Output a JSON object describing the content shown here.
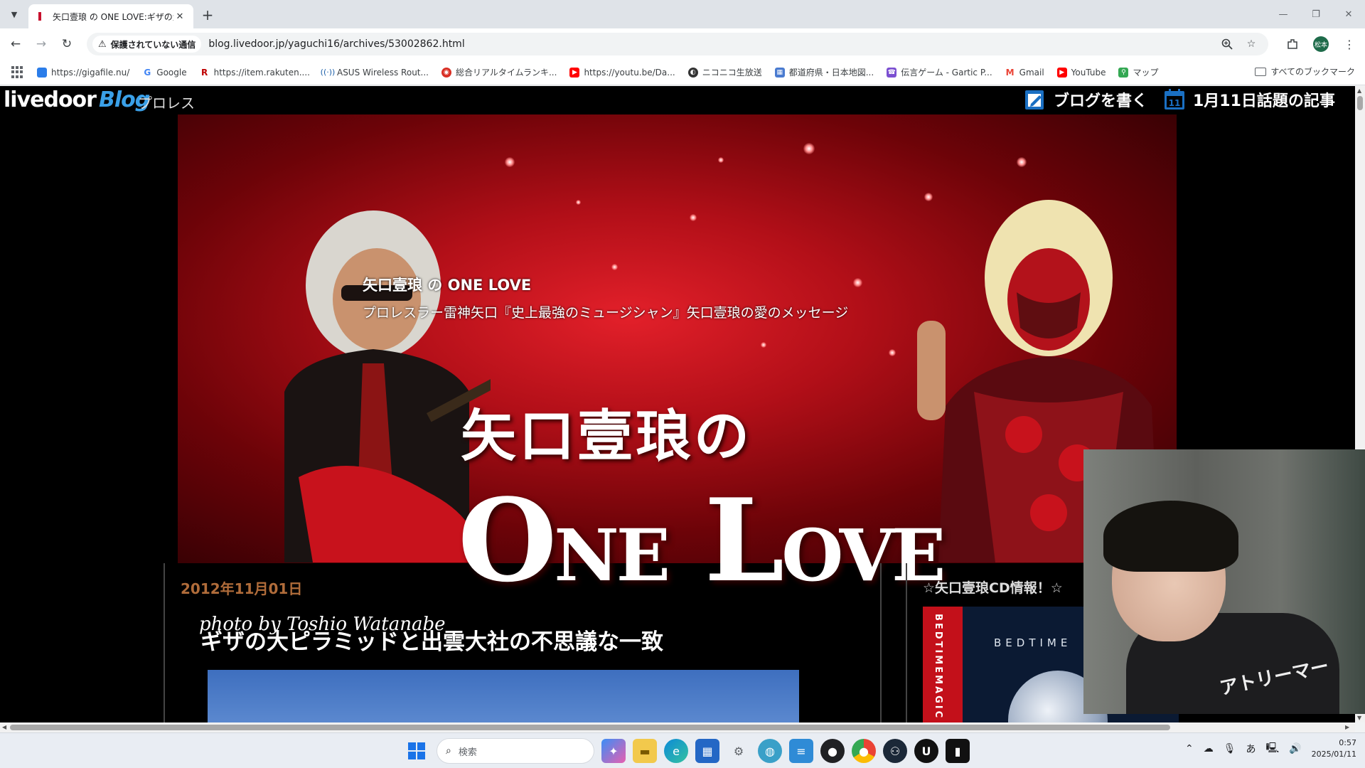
{
  "browser": {
    "tab": {
      "title": "矢口壹琅 の ONE LOVE:ギザの大",
      "close": "✕"
    },
    "new_tab": "+",
    "url": "blog.livedoor.jp/yaguchi16/archives/53002862.html",
    "security_label": "保護されていない通信",
    "profile_initials": "松本"
  },
  "bookmarks": {
    "items": [
      {
        "label": "https://gigafile.nu/",
        "color": "#2b7de9"
      },
      {
        "label": "Google",
        "color": "#4285f4"
      },
      {
        "label": "https://item.rakuten....",
        "color": "#bf0000"
      },
      {
        "label": "ASUS Wireless Rout...",
        "color": "#1a5ea8"
      },
      {
        "label": "総合リアルタイムランキ...",
        "color": "#d93025"
      },
      {
        "label": "https://youtu.be/Da...",
        "color": "#ff0000"
      },
      {
        "label": "ニコニコ生放送",
        "color": "#333333"
      },
      {
        "label": "都道府県・日本地図...",
        "color": "#4a7bd0"
      },
      {
        "label": "伝言ゲーム - Gartic P...",
        "color": "#7b4fd1"
      },
      {
        "label": "Gmail",
        "color": "#ea4335"
      },
      {
        "label": "YouTube",
        "color": "#ff0000"
      },
      {
        "label": "マップ",
        "color": "#34a853"
      }
    ],
    "all_bookmarks": "すべてのブックマーク"
  },
  "site": {
    "logo_text": "livedoor",
    "logo_blog": "Blog",
    "category": "プロレス",
    "write_blog": "ブログを書く",
    "trending": "1月11日話題の記事",
    "blog_title": "矢口壹琅 の ONE LOVE",
    "blog_description": "プロレスラー雷神矢口『史上最強のミュージシャン』矢口壹琅の愛のメッセージ",
    "banner_jp": "矢口壹琅の",
    "banner_one": "O",
    "banner_ne": "NE",
    "banner_love_l": "L",
    "banner_ove": "OVE",
    "banner_credit": "photo by Toshio Watanabe"
  },
  "post": {
    "date": "2012年11月01日",
    "title": "ギザの大ピラミッドと出雲大社の不思議な一致"
  },
  "sidebar": {
    "cd_title": "☆矢口壹琅CD情報！☆",
    "cd_band": "BEDTIMEMAGIC",
    "cd_word": "BEDTIME"
  },
  "webcam": {
    "shirt_text": "アトリーマー"
  },
  "taskbar": {
    "search_placeholder": "検索",
    "ime": "あ",
    "time": "0:57",
    "date": "2025/01/11"
  }
}
